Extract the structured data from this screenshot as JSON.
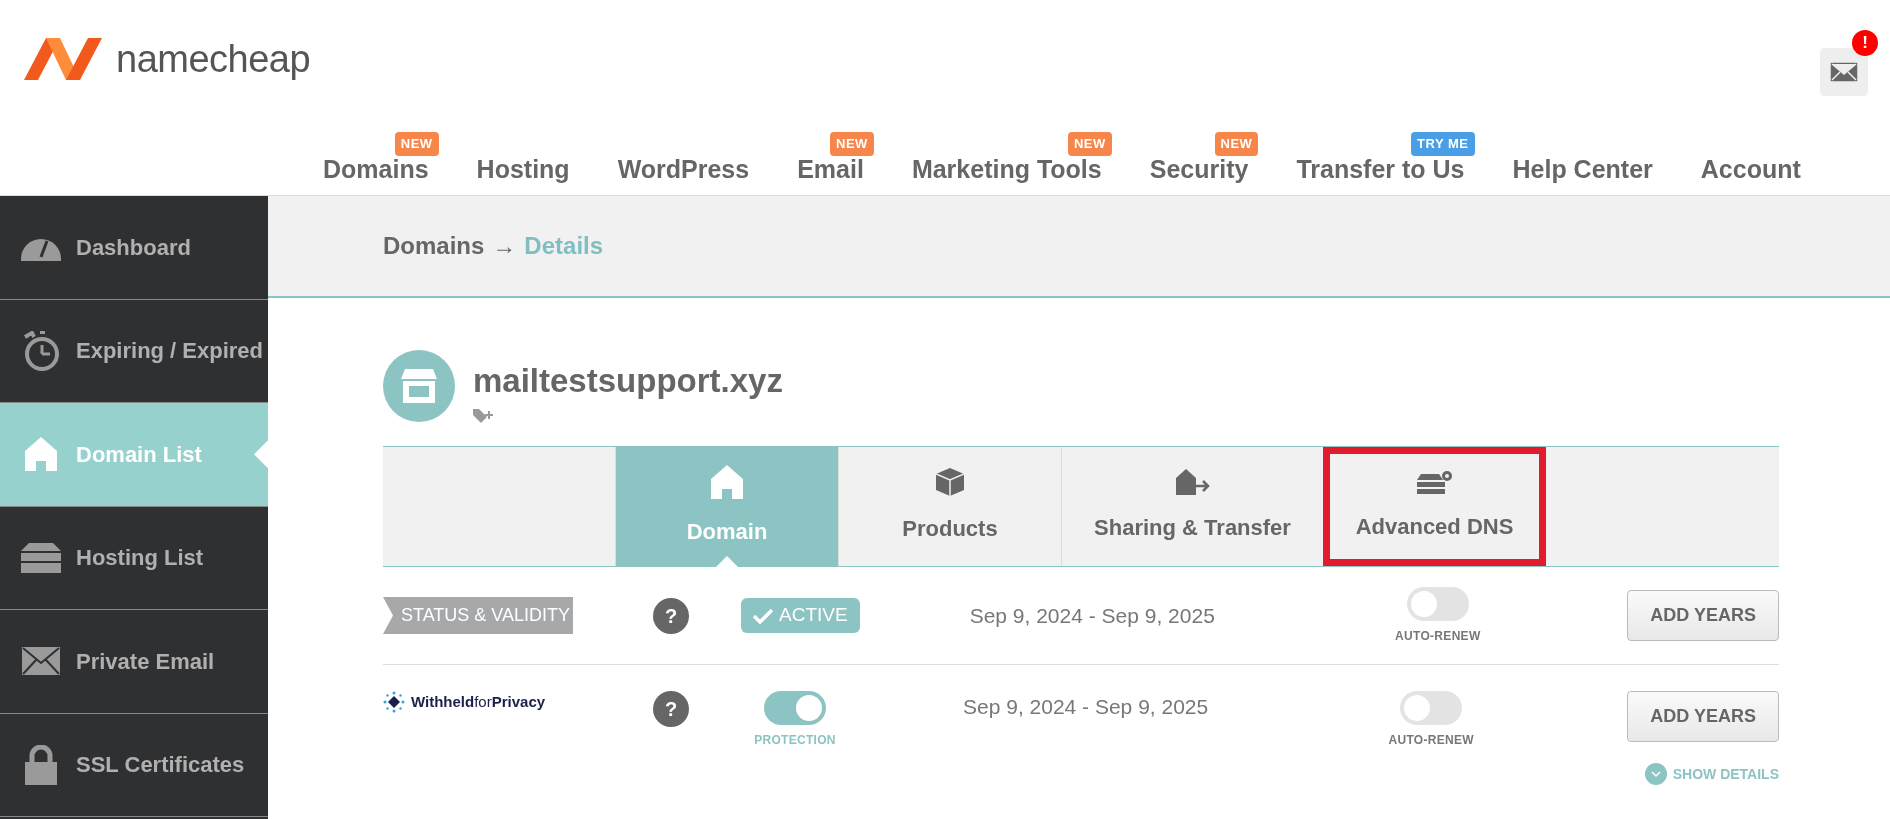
{
  "logo": {
    "text": "namecheap"
  },
  "mail": {
    "badge": "!"
  },
  "nav": [
    {
      "label": "Domains",
      "tag": {
        "text": "NEW",
        "color": "#f7864a"
      }
    },
    {
      "label": "Hosting"
    },
    {
      "label": "WordPress"
    },
    {
      "label": "Email",
      "tag": {
        "text": "NEW",
        "color": "#f7864a"
      }
    },
    {
      "label": "Marketing Tools",
      "tag": {
        "text": "NEW",
        "color": "#f7864a"
      }
    },
    {
      "label": "Security",
      "tag": {
        "text": "NEW",
        "color": "#f7864a"
      }
    },
    {
      "label": "Transfer to Us",
      "tag": {
        "text": "TRY ME",
        "color": "#4a9ee6"
      }
    },
    {
      "label": "Help Center"
    },
    {
      "label": "Account"
    }
  ],
  "sidebar": [
    {
      "label": "Dashboard",
      "selected": false
    },
    {
      "label": "Expiring / Expired",
      "selected": false
    },
    {
      "label": "Domain List",
      "selected": true
    },
    {
      "label": "Hosting List",
      "selected": false
    },
    {
      "label": "Private Email",
      "selected": false
    },
    {
      "label": "SSL Certificates",
      "selected": false
    }
  ],
  "breadcrumb": {
    "parent": "Domains",
    "arrow": "→",
    "current": "Details"
  },
  "domain": {
    "name": "mailtestsupport.xyz"
  },
  "tabs": [
    {
      "label": "Domain",
      "selected": true,
      "highlighted": false
    },
    {
      "label": "Products",
      "selected": false,
      "highlighted": false
    },
    {
      "label": "Sharing & Transfer",
      "selected": false,
      "highlighted": false
    },
    {
      "label": "Advanced DNS",
      "selected": false,
      "highlighted": true
    }
  ],
  "rows": [
    {
      "kind": "status",
      "label": "STATUS & VALIDITY",
      "help": "?",
      "status": "ACTIVE",
      "dates": "Sep 9, 2024 - Sep 9, 2025",
      "auto_renew": {
        "on": false,
        "label": "AUTO-RENEW"
      },
      "button": "ADD YEARS"
    },
    {
      "kind": "privacy",
      "brand": "**Withheld**for**Privacy**",
      "help": "?",
      "protection": {
        "on": true,
        "label": "PROTECTION"
      },
      "dates": "Sep 9, 2024 - Sep 9, 2025",
      "auto_renew": {
        "on": false,
        "label": "AUTO-RENEW"
      },
      "button": "ADD YEARS",
      "details_link": "SHOW DETAILS"
    }
  ]
}
